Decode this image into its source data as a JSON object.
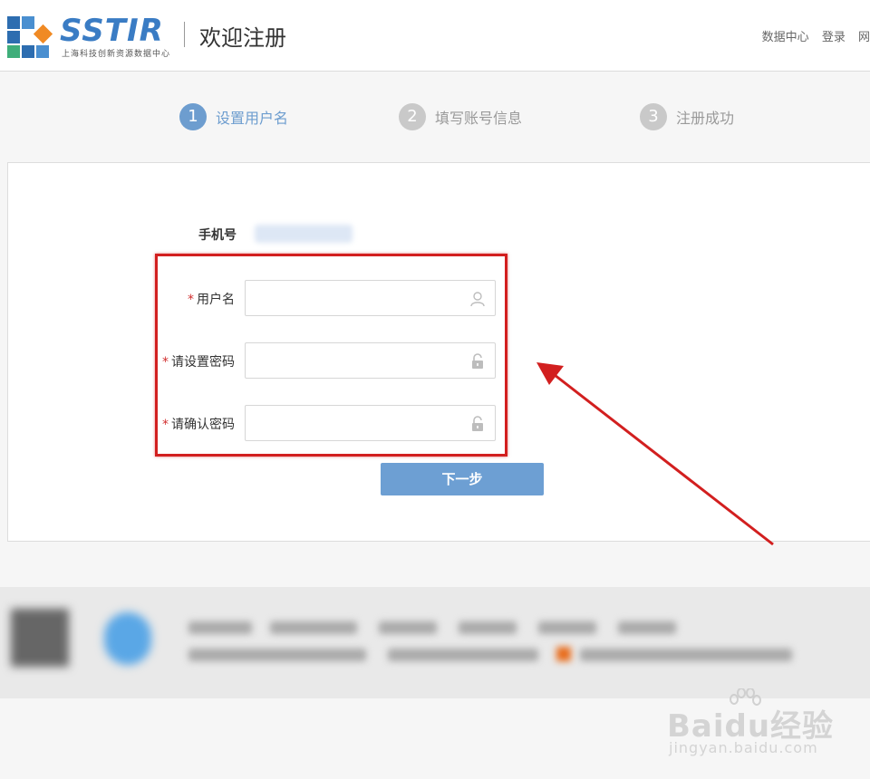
{
  "header": {
    "logo_text": "SSTIR",
    "logo_subtitle": "上海科技创新资源数据中心",
    "title": "欢迎注册",
    "links": [
      "数据中心",
      "登录",
      "网"
    ]
  },
  "steps": [
    {
      "num": "1",
      "label": "设置用户名",
      "active": true
    },
    {
      "num": "2",
      "label": "填写账号信息",
      "active": false
    },
    {
      "num": "3",
      "label": "注册成功",
      "active": false
    }
  ],
  "form": {
    "phone_label": "手机号",
    "required_mark": "*",
    "fields": [
      {
        "label": "用户名",
        "value": "",
        "icon": "user-icon"
      },
      {
        "label": "请设置密码",
        "value": "",
        "icon": "lock-icon"
      },
      {
        "label": "请确认密码",
        "value": "",
        "icon": "lock-icon"
      }
    ],
    "next_button": "下一步"
  },
  "watermark": {
    "main": "Baidu经验",
    "sub": "jingyan.baidu.com"
  },
  "colors": {
    "accent": "#6d9fd3",
    "annotation": "#d21f1f",
    "required": "#d12e2e"
  }
}
